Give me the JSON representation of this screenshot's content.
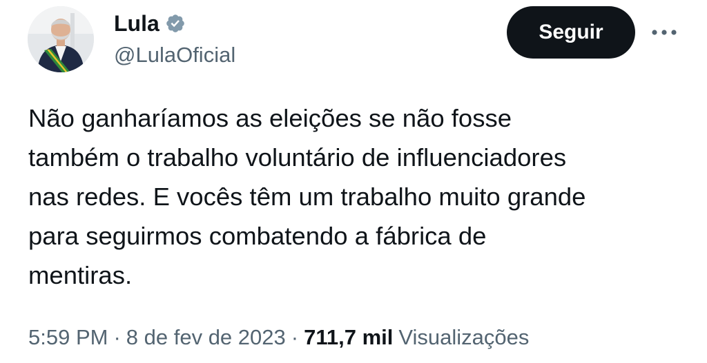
{
  "tweet": {
    "author": {
      "display_name": "Lula",
      "handle": "@LulaOficial",
      "verified": true,
      "avatar_icon": "profile-photo"
    },
    "follow_label": "Seguir",
    "more_icon": "more-horizontal-icon",
    "text": "Não ganharíamos as eleições se não fosse\ntambém o trabalho voluntário de influenciadores\nnas redes. E vocês têm um trabalho muito grande\npara seguirmos combatendo a fábrica de\nmentiras.",
    "time": "5:59 PM",
    "separator": "·",
    "date": "8 de fev de 2023",
    "views_count": "711,7 mil",
    "views_label": "Visualizações"
  },
  "colors": {
    "text_primary": "#0f1419",
    "text_secondary": "#536471",
    "button_bg": "#0f1419",
    "button_text": "#ffffff",
    "verified_badge": "#829aab"
  }
}
